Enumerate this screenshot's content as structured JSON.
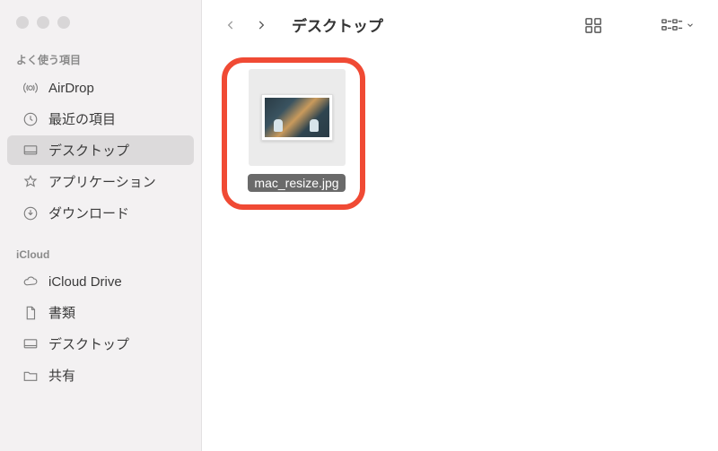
{
  "window": {
    "title": "デスクトップ"
  },
  "sidebar": {
    "sections": [
      {
        "header": "よく使う項目",
        "items": [
          {
            "icon": "airdrop",
            "label": "AirDrop"
          },
          {
            "icon": "clock",
            "label": "最近の項目"
          },
          {
            "icon": "desktop",
            "label": "デスクトップ",
            "selected": true
          },
          {
            "icon": "apps",
            "label": "アプリケーション"
          },
          {
            "icon": "download",
            "label": "ダウンロード"
          }
        ]
      },
      {
        "header": "iCloud",
        "items": [
          {
            "icon": "cloud",
            "label": "iCloud Drive"
          },
          {
            "icon": "document",
            "label": "書類"
          },
          {
            "icon": "desktop",
            "label": "デスクトップ"
          },
          {
            "icon": "folder",
            "label": "共有"
          }
        ]
      }
    ]
  },
  "files": [
    {
      "name": "mac_resize.jpg",
      "selected": true
    }
  ]
}
